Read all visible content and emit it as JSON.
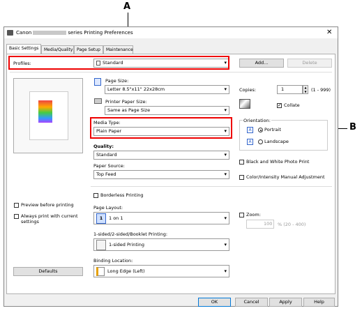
{
  "callouts": {
    "a": "A",
    "b": "B"
  },
  "window": {
    "title_prefix": "Canon",
    "title_suffix": "series Printing Preferences",
    "close": "✕"
  },
  "tabs": [
    "Basic Settings",
    "Media/Quality",
    "Page Setup",
    "Maintenance"
  ],
  "profiles": {
    "label": "Profiles:",
    "value": "Standard",
    "add": "Add...",
    "delete": "Delete"
  },
  "page_size": {
    "label": "Page Size:",
    "value": "Letter 8.5\"x11\" 22x28cm"
  },
  "printer_paper_size": {
    "label": "Printer Paper Size:",
    "value": "Same as Page Size"
  },
  "media_type": {
    "label": "Media Type:",
    "value": "Plain Paper"
  },
  "quality": {
    "label": "Quality:",
    "value": "Standard"
  },
  "paper_source": {
    "label": "Paper Source:",
    "value": "Top Feed"
  },
  "copies": {
    "label": "Copies:",
    "value": "1",
    "range": "(1 - 999)"
  },
  "collate": {
    "label": "Collate",
    "checked": true
  },
  "orientation": {
    "label": "Orientation:",
    "portrait": "Portrait",
    "landscape": "Landscape",
    "selected": "Portrait"
  },
  "bw_photo": "Black and White Photo Print",
  "color_intensity": "Color/Intensity Manual Adjustment",
  "preview_before": "Preview before printing",
  "always_print_1": "Always print with current",
  "always_print_2": "settings",
  "borderless": "Borderless Printing",
  "page_layout": {
    "label": "Page Layout:",
    "value": "1 on 1",
    "icon_num": "1"
  },
  "zoom": {
    "label": "Zoom:",
    "value": "100",
    "range": "% (20 - 400)"
  },
  "duplex": {
    "label": "1-sided/2-sided/Booklet Printing:",
    "value": "1-sided Printing"
  },
  "binding": {
    "label": "Binding Location:",
    "value": "Long Edge (Left)"
  },
  "defaults": "Defaults",
  "footer": {
    "ok": "OK",
    "cancel": "Cancel",
    "apply": "Apply",
    "help": "Help"
  },
  "icons": {
    "arrow": "▾",
    "spin_up": "▲",
    "spin_down": "▼"
  }
}
